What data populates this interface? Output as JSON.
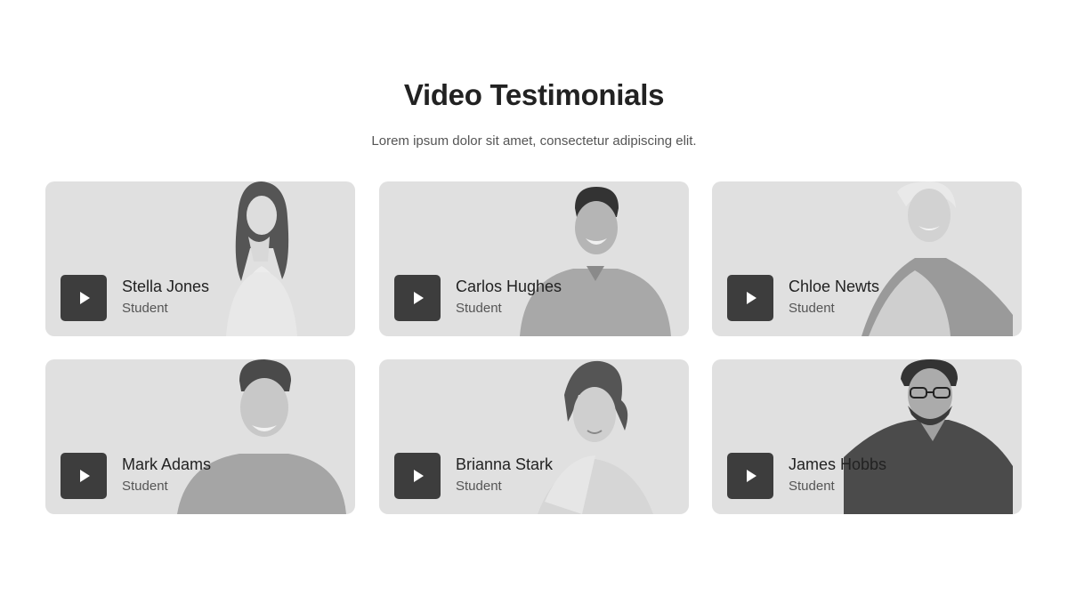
{
  "section": {
    "title": "Video Testimonials",
    "subtitle": "Lorem ipsum dolor sit amet, consectetur adipiscing elit."
  },
  "testimonials": [
    {
      "name": "Stella Jones",
      "role": "Student"
    },
    {
      "name": "Carlos Hughes",
      "role": "Student"
    },
    {
      "name": "Chloe Newts",
      "role": "Student"
    },
    {
      "name": "Mark Adams",
      "role": "Student"
    },
    {
      "name": "Brianna Stark",
      "role": "Student"
    },
    {
      "name": "James Hobbs",
      "role": "Student"
    }
  ],
  "colors": {
    "card_bg": "#e0e0e0",
    "play_button": "#3d3d3d",
    "title": "#222222",
    "text_muted": "#555555"
  },
  "icons": {
    "play": "play-icon"
  }
}
